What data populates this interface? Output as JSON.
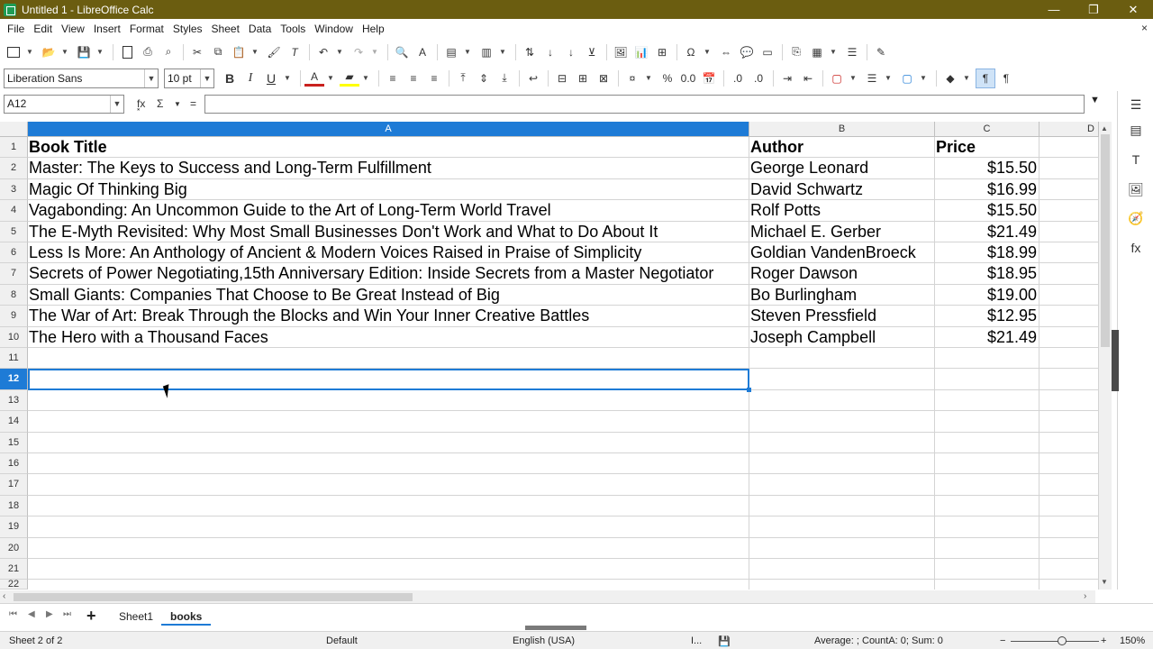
{
  "window": {
    "title": "Untitled 1 - LibreOffice Calc",
    "minimize": "—",
    "restore": "❐",
    "close": "✕"
  },
  "menu": [
    "File",
    "Edit",
    "View",
    "Insert",
    "Format",
    "Styles",
    "Sheet",
    "Data",
    "Tools",
    "Window",
    "Help"
  ],
  "doc_close": "×",
  "formatting": {
    "font_name": "Liberation Sans",
    "font_size": "10 pt"
  },
  "formula_bar": {
    "name_box": "A12",
    "fx": "f͓x",
    "sum": "Σ",
    "equals": "=",
    "content": ""
  },
  "grid": {
    "columns": [
      "A",
      "B",
      "C",
      "D"
    ],
    "rows": [
      "1",
      "2",
      "3",
      "4",
      "5",
      "6",
      "7",
      "8",
      "9",
      "10",
      "11",
      "12",
      "13",
      "14",
      "15",
      "16",
      "17",
      "18",
      "19",
      "20",
      "21",
      "22"
    ],
    "active_cell": "A12",
    "headers": [
      "Book Title",
      "Author",
      "Price"
    ],
    "data": [
      [
        "Master: The Keys to Success and Long-Term Fulfillment",
        "George Leonard",
        "$15.50"
      ],
      [
        "Magic Of Thinking Big",
        "David Schwartz",
        "$16.99"
      ],
      [
        "Vagabonding: An Uncommon Guide to the Art of Long-Term World Travel",
        "Rolf Potts",
        "$15.50"
      ],
      [
        "The E-Myth Revisited: Why Most Small Businesses Don't Work and What to Do About It",
        "Michael E. Gerber",
        "$21.49"
      ],
      [
        "Less Is More: An Anthology of Ancient & Modern Voices Raised in Praise of Simplicity",
        "Goldian VandenBroeck",
        "$18.99"
      ],
      [
        "Secrets of Power Negotiating,15th Anniversary Edition: Inside Secrets from a Master Negotiator",
        "Roger Dawson",
        "$18.95"
      ],
      [
        "Small Giants: Companies That Choose to Be Great Instead of Big",
        "Bo Burlingham",
        "$19.00"
      ],
      [
        "The War of Art: Break Through the Blocks and Win Your Inner Creative Battles",
        "Steven Pressfield",
        "$12.95"
      ],
      [
        "The Hero with a Thousand Faces",
        "Joseph Campbell",
        "$21.49"
      ]
    ]
  },
  "sheets": {
    "tabs": [
      "Sheet1",
      "books"
    ],
    "active": "books",
    "add": "+"
  },
  "status": {
    "sheet": "Sheet 2 of 2",
    "page_style": "Default",
    "language": "English (USA)",
    "selection_mode": "I...",
    "summary": "Average: ; CountA: 0; Sum: 0",
    "zoom_minus": "−",
    "zoom_plus": "+",
    "zoom": "150%"
  },
  "accent_color": "#1e7bd6",
  "titlebar_color": "#6b5d10"
}
